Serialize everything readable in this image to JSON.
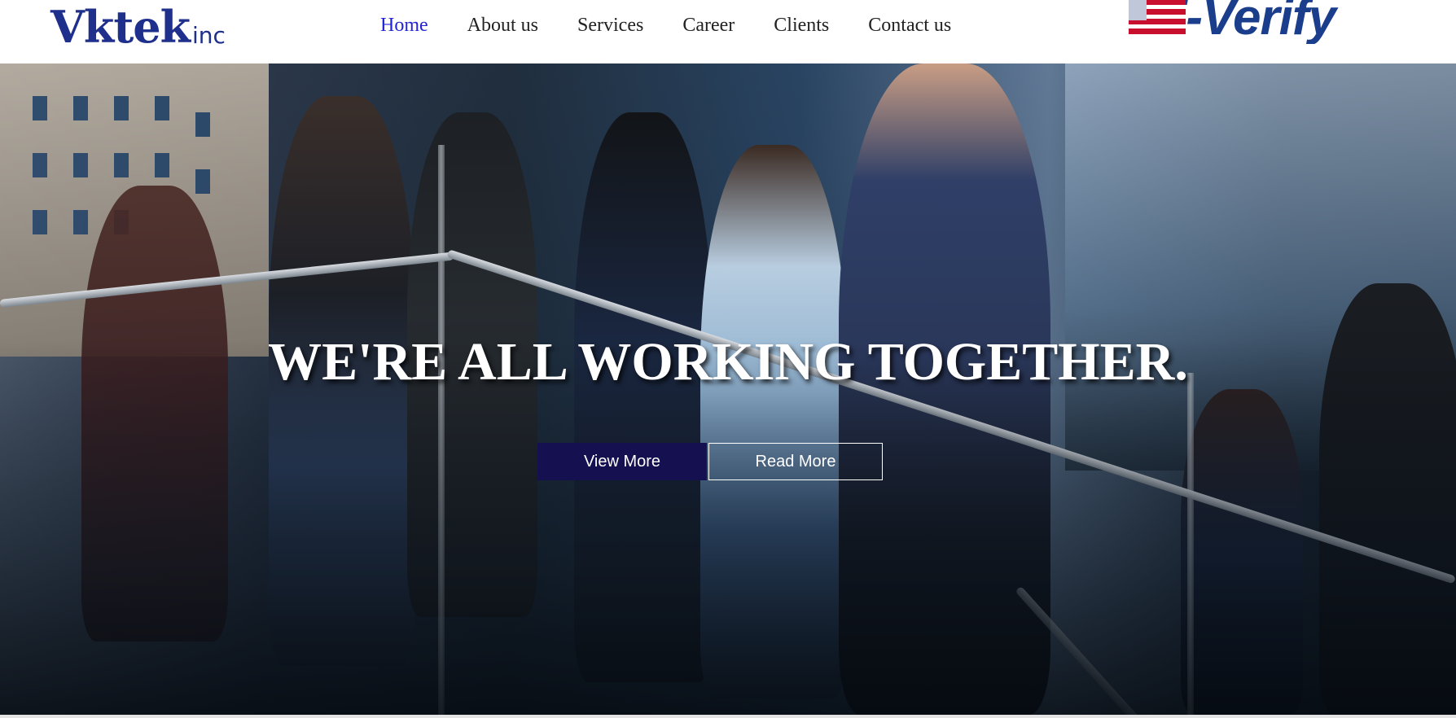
{
  "header": {
    "logo": {
      "main": "Vktek",
      "suffix": "inc"
    },
    "nav": [
      {
        "label": "Home",
        "active": true
      },
      {
        "label": "About us",
        "active": false
      },
      {
        "label": "Services",
        "active": false
      },
      {
        "label": "Career",
        "active": false
      },
      {
        "label": "Clients",
        "active": false
      },
      {
        "label": "Contact us",
        "active": false
      }
    ],
    "badge": {
      "text": "E-Verify",
      "icon": "us-flag-icon"
    }
  },
  "hero": {
    "title": "WE'RE ALL WORKING TOGETHER.",
    "buttons": {
      "view_more": "View More",
      "read_more": "Read More"
    }
  },
  "colors": {
    "brand_blue": "#1f2f8c",
    "nav_active": "#2323d6",
    "nav_text": "#222222",
    "button_primary": "#15104f",
    "everify_blue": "#1a3e8c",
    "everify_red": "#c8102e"
  }
}
